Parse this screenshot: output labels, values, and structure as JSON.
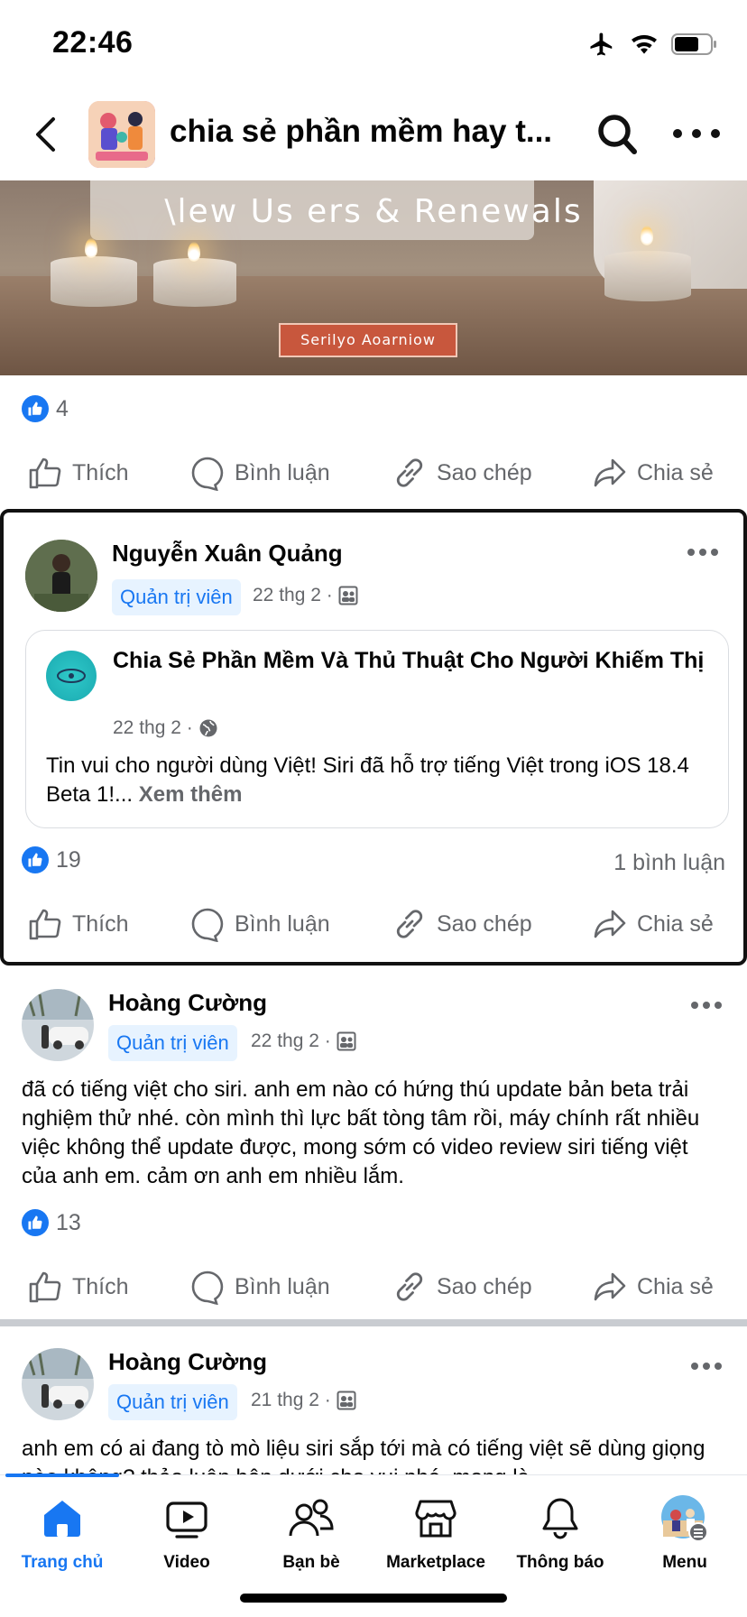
{
  "status_bar": {
    "time": "22:46"
  },
  "header": {
    "title": "chia sẻ phần mềm hay t..."
  },
  "banner": {
    "title": "\\lew Us ers & Renewals",
    "button_label": "Serilyo Aoarniow"
  },
  "actions": {
    "like": "Thích",
    "comment": "Bình luận",
    "copy": "Sao chép",
    "share": "Chia sẻ"
  },
  "post0": {
    "likes": "4"
  },
  "post1": {
    "author": "Nguyễn Xuân Quảng",
    "role": "Quản trị viên",
    "date": "22 thg 2 ·",
    "shared": {
      "title": "Chia Sẻ Phần Mềm Và Thủ Thuật Cho Người Khiếm Thị",
      "date": "22 thg 2 ·",
      "text": "Tin vui cho người dùng Việt! Siri đã hỗ trợ tiếng Việt trong iOS 18.4 Beta 1!...",
      "see_more": "Xem thêm"
    },
    "likes": "19",
    "comments": "1 bình luận"
  },
  "post2": {
    "author": "Hoàng Cường",
    "role": "Quản trị viên",
    "date": "22 thg 2 ·",
    "text": "đã có tiếng việt cho siri. anh em nào có hứng thú update bản beta trải nghiệm thử nhé. còn mình thì lực bất tòng tâm rồi, máy chính rất nhiều việc không thể update được, mong sớm có video review siri tiếng việt của anh em. cảm ơn anh em nhiều lắm.",
    "likes": "13"
  },
  "post3": {
    "author": "Hoàng Cường",
    "role": "Quản trị viên",
    "date": "21 thg 2 ·",
    "text": "anh em có ai đang tò mò liệu siri sắp tới mà có tiếng việt sẽ dùng giọng nào không? thảo luận bên dưới cho vui nhé, mong là"
  },
  "bottom_nav": {
    "items": [
      {
        "label": "Trang chủ",
        "icon": "home-icon",
        "active": true
      },
      {
        "label": "Video",
        "icon": "video-icon"
      },
      {
        "label": "Bạn bè",
        "icon": "friends-icon"
      },
      {
        "label": "Marketplace",
        "icon": "marketplace-icon"
      },
      {
        "label": "Thông báo",
        "icon": "bell-icon"
      },
      {
        "label": "Menu",
        "icon": "menu-avatar"
      }
    ]
  },
  "colors": {
    "accent": "#1877f2",
    "secondary_text": "#65676b",
    "badge_bg": "#e7f3ff"
  }
}
